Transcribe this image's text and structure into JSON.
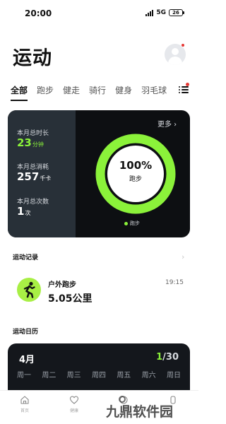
{
  "status_bar": {
    "time": "20:00",
    "network": "5G",
    "battery": "26"
  },
  "header": {
    "title": "运动"
  },
  "tabs": [
    {
      "label": "全部",
      "active": true
    },
    {
      "label": "跑步"
    },
    {
      "label": "健走"
    },
    {
      "label": "骑行"
    },
    {
      "label": "健身"
    },
    {
      "label": "羽毛球"
    }
  ],
  "summary": {
    "duration_label": "本月总时长",
    "duration_value": "23",
    "duration_unit": "分钟",
    "calories_label": "本月总消耗",
    "calories_value": "257",
    "calories_unit": "千卡",
    "count_label": "本月总次数",
    "count_value": "1",
    "count_unit": "次",
    "more": "更多",
    "ring_percent": "100%",
    "ring_caption": "跑步",
    "legend": "跑步",
    "accent_color": "#8bf23a",
    "ring_progress": 1.0
  },
  "records": {
    "section_title": "运动记录",
    "items": [
      {
        "name": "户外跑步",
        "time": "19:15",
        "distance": "5.05公里"
      }
    ]
  },
  "calendar": {
    "section_title": "运动日历",
    "month": "4月",
    "count_done": "1",
    "count_total": "/30",
    "weekdays": [
      "周一",
      "周二",
      "周三",
      "周四",
      "周五",
      "周六",
      "周日"
    ]
  },
  "bottom_nav": [
    {
      "label": "首页",
      "icon": "home-icon"
    },
    {
      "label": "健康",
      "icon": "heart-icon"
    },
    {
      "label": "",
      "icon": "discover-icon"
    },
    {
      "label": "",
      "icon": "device-icon"
    }
  ],
  "watermark": "九鼎软件园"
}
